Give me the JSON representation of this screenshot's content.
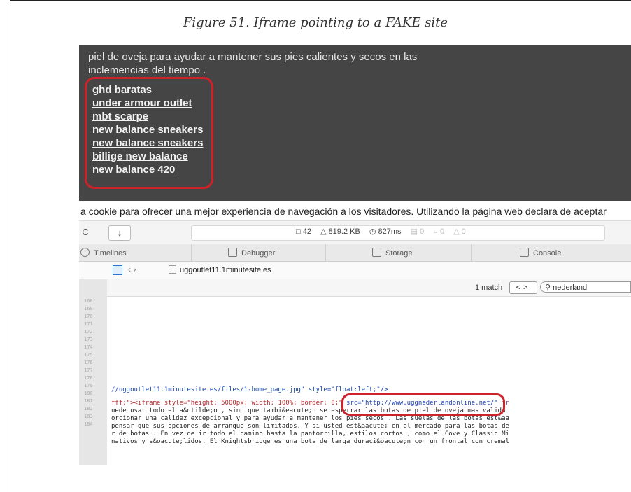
{
  "figure": {
    "caption": "Figure 51. Iframe pointing to a FAKE site"
  },
  "page_text": {
    "line1": "piel de oveja para ayudar a mantener sus pies calientes y secos en las",
    "line2": "inclemencias del tiempo ."
  },
  "spam_links": [
    "ghd baratas",
    "under armour outlet",
    "mbt scarpe",
    "new balance sneakers",
    "new balance sneakers",
    "billige new balance",
    "new balance 420"
  ],
  "cookie_notice": "a cookie para ofrecer una mejor experiencia de navegación a los visitadores. Utilizando la página web declara de aceptar",
  "toolbar": {
    "reload_icon": "C",
    "download_icon": "↓",
    "resources": "42",
    "size": "819.2 KB",
    "time": "827ms",
    "errors": "0",
    "warnings": "0",
    "logs": "0"
  },
  "devtools_tabs": [
    "Timelines",
    "Debugger",
    "Storage",
    "Console"
  ],
  "address": {
    "domain": "uggoutlet11.1minutesite.es",
    "nav": "‹  ›"
  },
  "search": {
    "match_count": "1 match",
    "query": "nederland",
    "prev_next": "<>"
  },
  "code": {
    "line_numbers": [
      "168",
      "169",
      "170",
      "171",
      "172",
      "173",
      "174",
      "175",
      "176",
      "177",
      "178",
      "179",
      "180",
      "181",
      "182",
      "183",
      "184"
    ],
    "img_line": "//uggoutlet11.1minutesite.es/files/1-home_page.jpg\" style=\"float:left;\"/>",
    "iframe_pre": "fff;\"><iframe style=\"height: 5000px; width: 100%; border: 0;\" ",
    "iframe_src": "src=\"http://www.uggnederlandonline.net/\"",
    "iframe_post": " fr",
    "text_lines": [
      "uede usar todo el a&ntilde;o , sino que tambi&eacute;n se esperrar las botas de piel de oveja mas valida",
      "orcionar una calidez excepcional y para ayudar a mantener los pies secos . Las suelas de las botas est&aa",
      "pensar que sus opciones de arranque son limitados. Y si usted est&aacute; en el mercado para las botas de",
      "r de botas . En vez de ir todo el camino hasta la pantorrilla, estilos cortos , como el Cove y Classic Mi",
      "nativos y s&oacute;lidos. El Knightsbridge es una bota de larga duraci&oacute;n con un frontal con cremal"
    ]
  },
  "colors": {
    "highlight_ring": "#cc2229",
    "page_dark": "#454545"
  }
}
